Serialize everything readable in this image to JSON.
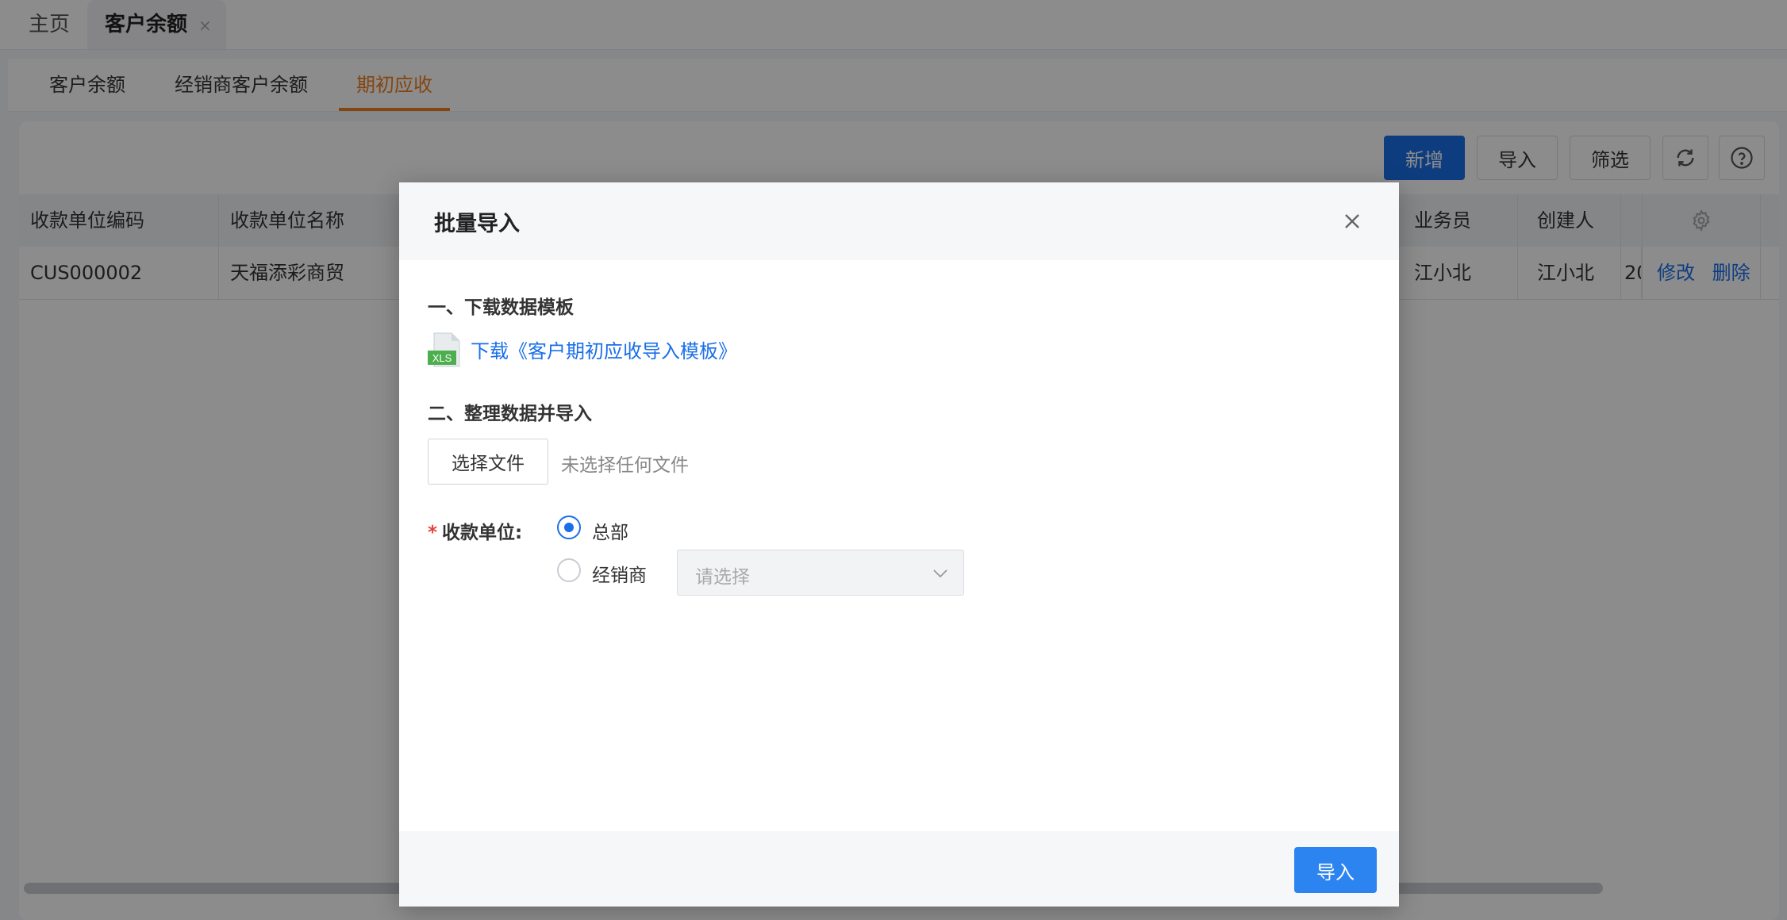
{
  "top_tabs": {
    "home": "主页",
    "active": "客户余额",
    "close": "×"
  },
  "sub_tabs": [
    "客户余额",
    "经销商客户余额",
    "期初应收"
  ],
  "toolbar": {
    "add": "新增",
    "import": "导入",
    "filter": "筛选",
    "refresh_icon": "refresh-icon",
    "help_icon": "help-icon"
  },
  "table": {
    "columns": [
      "收款单位编码",
      "收款单位名称",
      "业务员",
      "创建人"
    ],
    "rows": [
      {
        "code": "CUS000002",
        "name": "天福添彩商贸",
        "salesman": "江小北",
        "creator": "江小北",
        "date_partial": "20",
        "edit": "修改",
        "delete": "删除"
      }
    ]
  },
  "dialog": {
    "title": "批量导入",
    "step1_title": "一、下载数据模板",
    "file_icon_text": "XLS",
    "download_link": "下载《客户期初应收导入模板》",
    "step2_title": "二、整理数据并导入",
    "choose_file": "选择文件",
    "no_file": "未选择任何文件",
    "required_star": "*",
    "unit_label": "收款单位:",
    "option_hq": "总部",
    "option_dealer": "经销商",
    "selected_option": "总部",
    "dealer_select_placeholder": "请选择",
    "import_button": "导入"
  },
  "colors": {
    "primary": "#1a6fe8",
    "active_tab": "#f07f1e",
    "required": "#e5413c"
  }
}
